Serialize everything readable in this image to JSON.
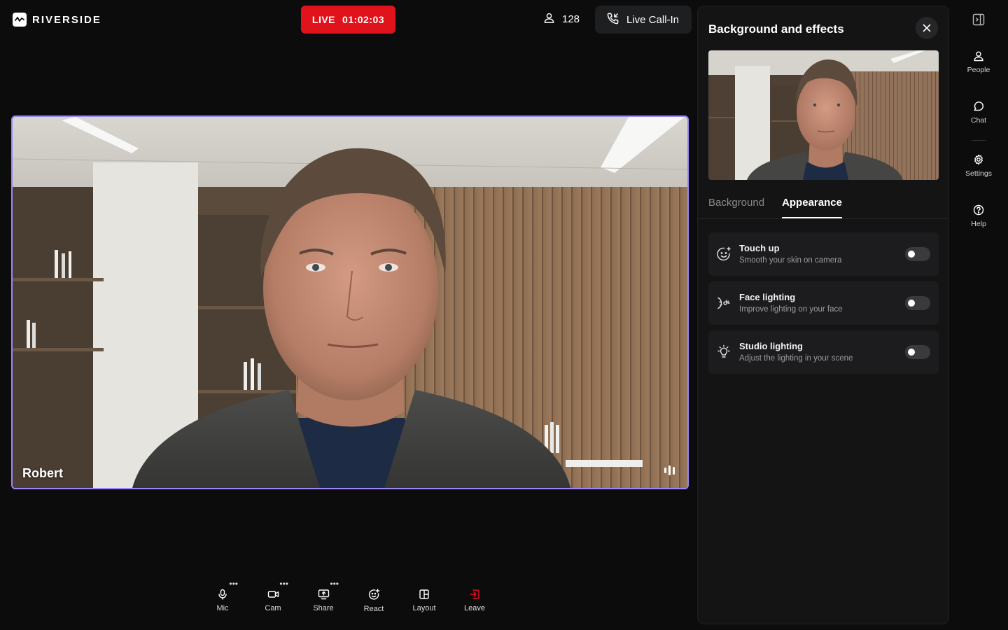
{
  "app": {
    "name": "RIVERSIDE"
  },
  "header": {
    "live_label": "LIVE",
    "live_timer": "01:02:03",
    "viewer_count": "128",
    "callin_label": "Live Call-In"
  },
  "video": {
    "participant_name": "Robert",
    "border_color": "#9b87f5"
  },
  "toolbar": {
    "items": [
      {
        "label": "Mic",
        "icon": "mic-icon",
        "has_menu": true
      },
      {
        "label": "Cam",
        "icon": "camera-icon",
        "has_menu": true
      },
      {
        "label": "Share",
        "icon": "screen-share-icon",
        "has_menu": true
      },
      {
        "label": "React",
        "icon": "emoji-react-icon",
        "has_menu": false
      },
      {
        "label": "Layout",
        "icon": "layout-icon",
        "has_menu": false
      },
      {
        "label": "Leave",
        "icon": "leave-icon",
        "has_menu": false,
        "color": "#e0121b"
      }
    ]
  },
  "panel": {
    "title": "Background and effects",
    "tabs": [
      {
        "label": "Background",
        "active": false
      },
      {
        "label": "Appearance",
        "active": true
      }
    ],
    "options": [
      {
        "title": "Touch up",
        "subtitle": "Smooth your skin on camera",
        "enabled": false,
        "icon": "face-sparkle-icon"
      },
      {
        "title": "Face lighting",
        "subtitle": "Improve lighting on your face",
        "enabled": false,
        "icon": "face-light-icon"
      },
      {
        "title": "Studio lighting",
        "subtitle": "Adjust the lighting in your scene",
        "enabled": false,
        "icon": "bulb-icon"
      }
    ]
  },
  "rail": {
    "items": [
      {
        "label": "People",
        "icon": "people-icon"
      },
      {
        "label": "Chat",
        "icon": "chat-icon"
      },
      {
        "label": "Settings",
        "icon": "gear-icon"
      },
      {
        "label": "Help",
        "icon": "help-icon"
      }
    ]
  },
  "colors": {
    "live_red": "#e0121b",
    "background": "#0c0c0d",
    "panel": "#141415"
  }
}
